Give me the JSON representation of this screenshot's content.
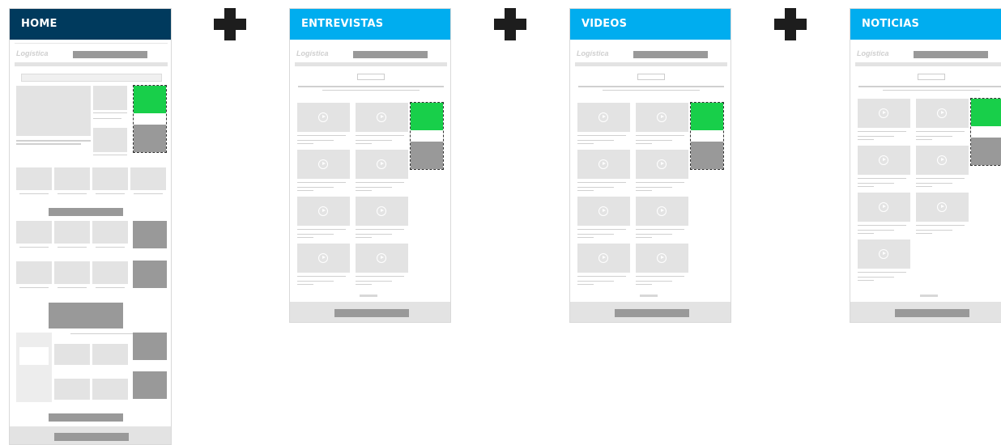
{
  "colors": {
    "home_header": "#003a5d",
    "section_header": "#00adef",
    "ad_green": "#18cf4a",
    "ad_gray": "#999999",
    "placeholder": "#e3e3e3"
  },
  "connector": "plus-icon",
  "panels": [
    {
      "title": "HOME"
    },
    {
      "title": "ENTREVISTAS"
    },
    {
      "title": "VIDEOS"
    },
    {
      "title": "NOTICIAS"
    }
  ],
  "logo_text": "Logística"
}
